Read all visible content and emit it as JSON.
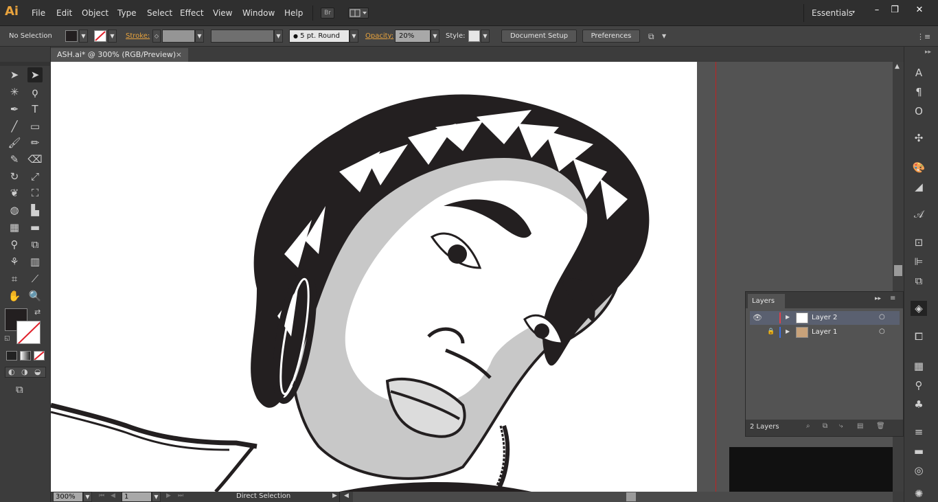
{
  "app": {
    "logo": "Ai",
    "menus": [
      "File",
      "Edit",
      "Object",
      "Type",
      "Select",
      "Effect",
      "View",
      "Window",
      "Help"
    ],
    "bridge_label": "Br",
    "workspace": "Essentials",
    "window_controls": [
      "minimize-icon",
      "restore-icon",
      "close-icon"
    ]
  },
  "control_bar": {
    "selection": "No Selection",
    "stroke_label": "Stroke:",
    "brush": "5 pt. Round",
    "opacity_label": "Opacity:",
    "opacity_value": "20%",
    "style_label": "Style:",
    "document_setup": "Document Setup",
    "preferences": "Preferences"
  },
  "document": {
    "tab_title": "ASH.ai* @ 300% (RGB/Preview)",
    "close_glyph": "×"
  },
  "tools": [
    "selection-tool",
    "direct-selection-tool",
    "magic-wand-tool",
    "lasso-tool",
    "pen-tool",
    "type-tool",
    "line-tool",
    "rectangle-tool",
    "paintbrush-tool",
    "pencil-tool",
    "blob-brush-tool",
    "eraser-tool",
    "rotate-tool",
    "scale-tool",
    "warp-tool",
    "free-transform-tool",
    "shape-builder-tool",
    "perspective-grid-tool",
    "mesh-tool",
    "gradient-tool",
    "eyedropper-tool",
    "blend-tool",
    "symbol-sprayer-tool",
    "column-graph-tool",
    "artboard-tool",
    "slice-tool",
    "hand-tool",
    "zoom-tool"
  ],
  "colors": {
    "fill": "#231f20",
    "accent_orange": "#e8a33d",
    "layer2_color": "#e0414a",
    "layer1_color": "#3d6fe0",
    "selected_row": "#5a6070"
  },
  "layers_panel": {
    "title": "Layers",
    "layers": [
      {
        "name": "Layer 2",
        "visible": true,
        "locked": false,
        "selected": true
      },
      {
        "name": "Layer 1",
        "visible": false,
        "locked": true,
        "selected": false
      }
    ],
    "count": "2 Layers"
  },
  "status_bar": {
    "zoom": "300%",
    "artboard": "1",
    "tool_name": "Direct Selection"
  },
  "dock_icons": [
    "character-icon",
    "paragraph-icon",
    "opentype-icon",
    "symbols-icon",
    "color-guide-icon",
    "swatches-icon",
    "graphic-styles-icon",
    "transform-icon",
    "align-icon",
    "pathfinder-icon",
    "layers-icon",
    "artboards-icon",
    "navigator-icon",
    "links-icon",
    "club-icon",
    "stroke-icon",
    "gradient-icon",
    "transparency-icon",
    "appearance-icon"
  ]
}
